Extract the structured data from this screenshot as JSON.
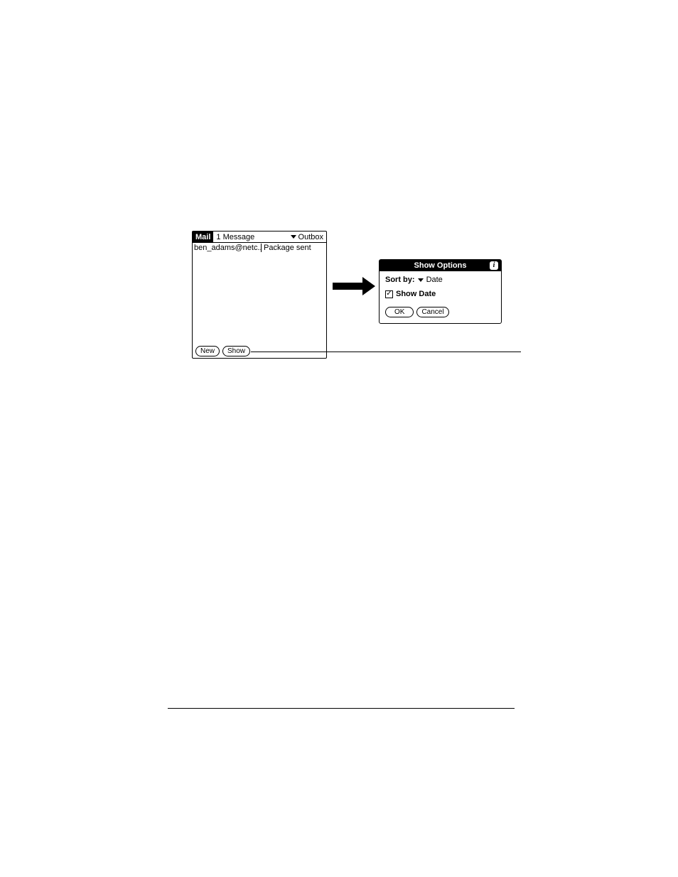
{
  "mail": {
    "app_title": "Mail",
    "message_count": "1 Message",
    "folder": "Outbox",
    "row": {
      "from": "ben_adams@netc...",
      "subject": "Package sent"
    },
    "buttons": {
      "new": "New",
      "show": "Show"
    }
  },
  "options": {
    "title": "Show Options",
    "info_glyph": "i",
    "sort_by_label": "Sort by:",
    "sort_by_value": "Date",
    "show_date_label": "Show Date",
    "checkbox_checked": "✓",
    "ok": "OK",
    "cancel": "Cancel"
  }
}
